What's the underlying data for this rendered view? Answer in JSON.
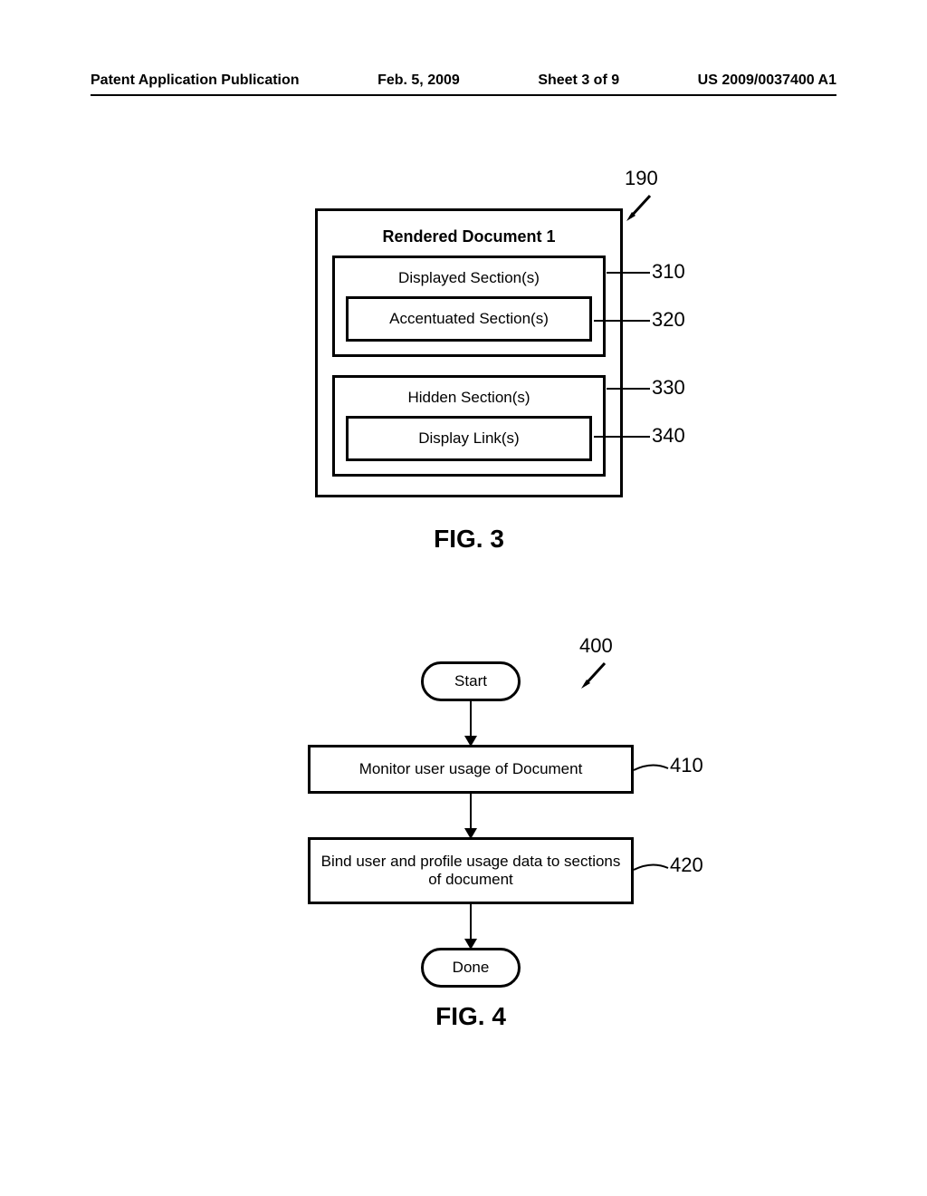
{
  "header": {
    "pub_type": "Patent Application Publication",
    "date": "Feb. 5, 2009",
    "sheet": "Sheet 3 of 9",
    "pub_number": "US 2009/0037400 A1"
  },
  "fig3": {
    "ref_overall": "190",
    "title": "Rendered Document 1",
    "displayed": {
      "label": "Displayed Section(s)",
      "ref": "310"
    },
    "accentuated": {
      "label": "Accentuated Section(s)",
      "ref": "320"
    },
    "hidden": {
      "label": "Hidden Section(s)",
      "ref": "330"
    },
    "display_link": {
      "label": "Display Link(s)",
      "ref": "340"
    },
    "caption": "FIG. 3"
  },
  "fig4": {
    "ref_overall": "400",
    "start": "Start",
    "step1": {
      "label": "Monitor user usage of Document",
      "ref": "410"
    },
    "step2": {
      "label": "Bind user and profile usage data to sections of document",
      "ref": "420"
    },
    "done": "Done",
    "caption": "FIG. 4"
  }
}
